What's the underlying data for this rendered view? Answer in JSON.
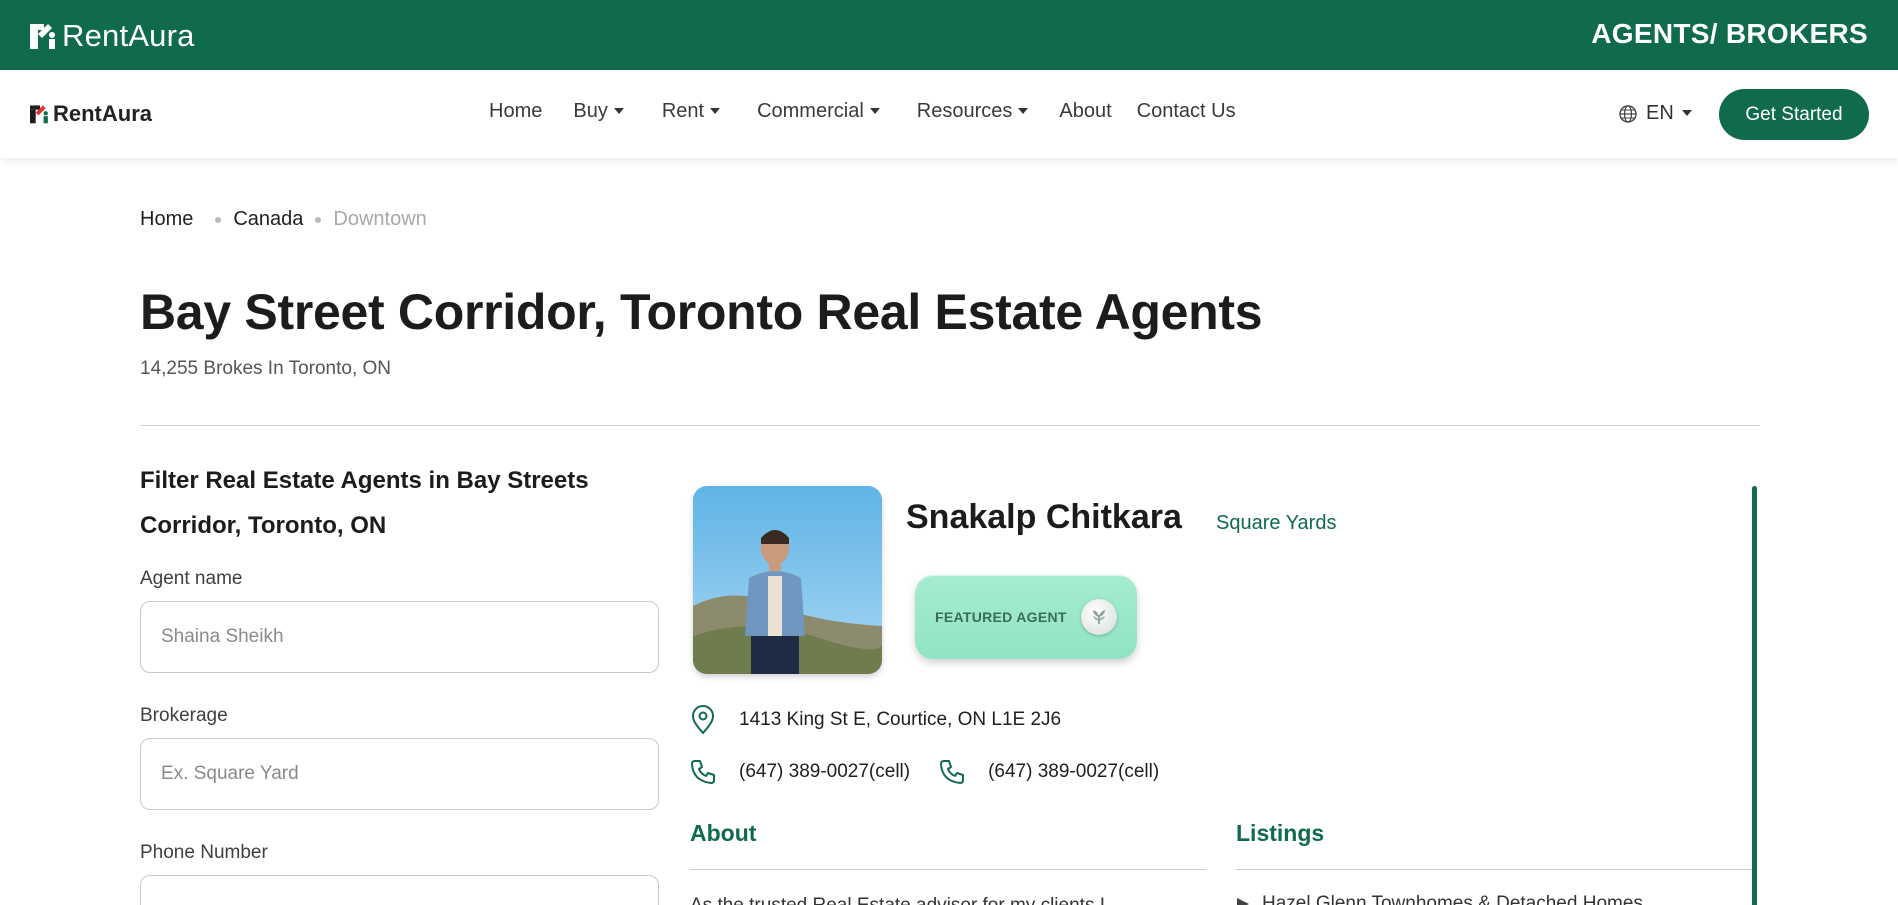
{
  "topbar": {
    "brand": "RentAura",
    "section_title": "AGENTS/ BROKERS"
  },
  "nav": {
    "brand": "RentAura",
    "links": [
      {
        "label": "Home",
        "dropdown": false
      },
      {
        "label": "Buy",
        "dropdown": true
      },
      {
        "label": "Rent",
        "dropdown": true
      },
      {
        "label": "Commercial",
        "dropdown": true
      },
      {
        "label": "Resources",
        "dropdown": true
      },
      {
        "label": "About",
        "dropdown": false
      },
      {
        "label": "Contact Us",
        "dropdown": false
      }
    ],
    "language": "EN",
    "cta": "Get Started"
  },
  "breadcrumb": [
    "Home",
    "Canada",
    "Downtown"
  ],
  "page": {
    "title": "Bay Street Corridor, Toronto Real Estate Agents",
    "subtitle": "14,255 Brokes In Toronto, ON"
  },
  "filter": {
    "title": "Filter Real Estate Agents in Bay Streets Corridor, Toronto, ON",
    "agent_name_label": "Agent name",
    "agent_name_placeholder": "Shaina Sheikh",
    "brokerage_label": "Brokerage",
    "brokerage_placeholder": "Ex. Square Yard",
    "phone_label": "Phone Number"
  },
  "agent": {
    "name": "Snakalp Chitkara",
    "brokerage": "Square Yards",
    "badge": "FEATURED AGENT",
    "address": "1413 King St E, Courtice, ON L1E 2J6",
    "phones": [
      "(647) 389-0027(cell)",
      "(647) 389-0027(cell)"
    ],
    "about_heading": "About",
    "about_text": "As the trusted Real Estate advisor for my clients I",
    "listings_heading": "Listings",
    "listing_first": "Hazel Glenn Townhomes & Detached Homes"
  },
  "colors": {
    "brand_green": "#0f6b4b",
    "badge_mint": "#9ae8c9"
  }
}
